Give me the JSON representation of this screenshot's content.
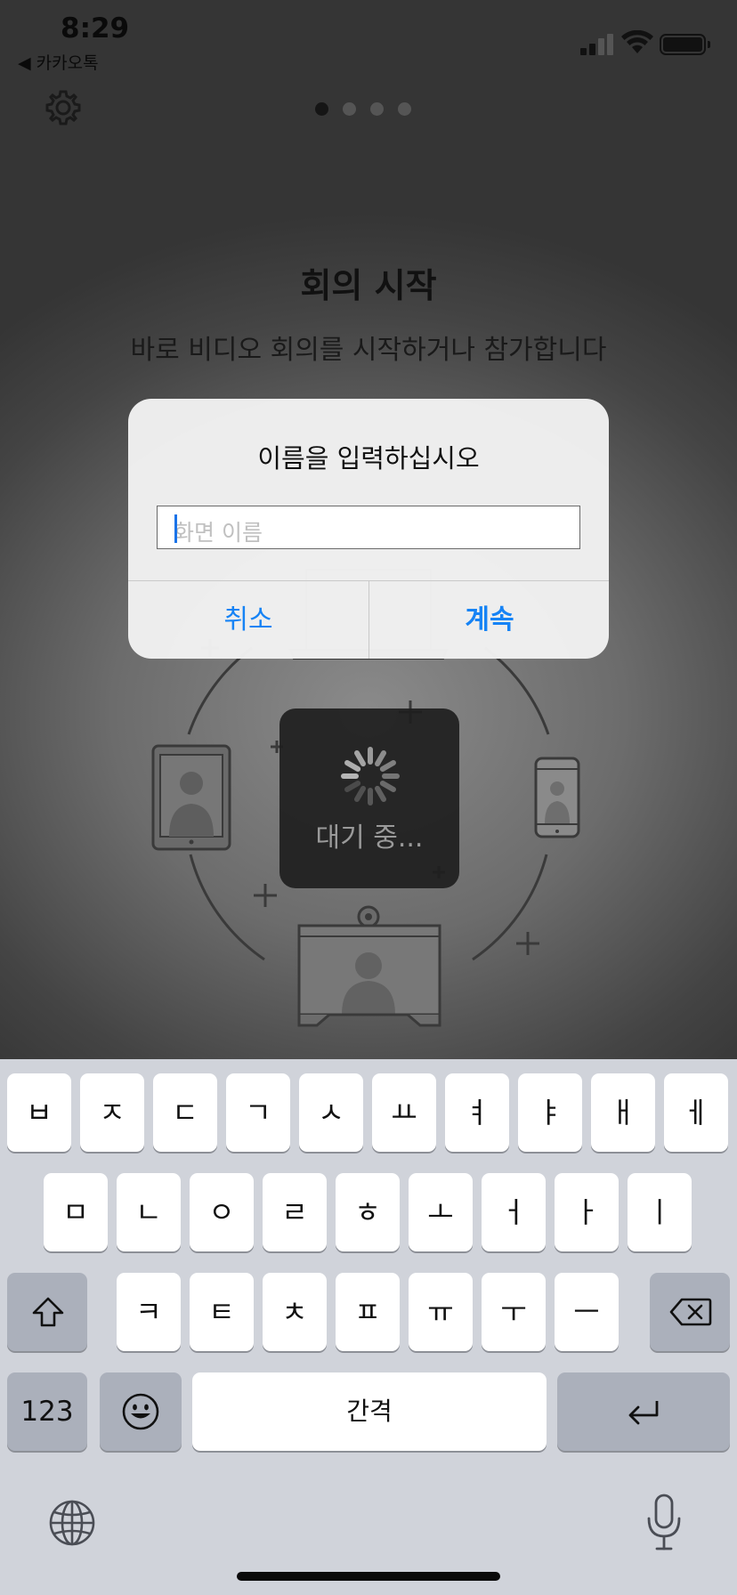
{
  "status_bar": {
    "time": "8:29",
    "back_app": "◀ 카카오톡"
  },
  "onboarding": {
    "page_dots": 4,
    "active_dot": 1,
    "title": "회의 시작",
    "subtitle": "바로 비디오 회의를 시작하거나 참가합니다"
  },
  "loading_hud": {
    "text": "대기 중..."
  },
  "dialog": {
    "title": "이름을 입력하십시오",
    "input_placeholder": "화면 이름",
    "input_value": "",
    "cancel_label": "취소",
    "continue_label": "계속",
    "accent_color": "#1683f5"
  },
  "keyboard": {
    "row1": [
      "ㅂ",
      "ㅈ",
      "ㄷ",
      "ㄱ",
      "ㅅ",
      "ㅛ",
      "ㅕ",
      "ㅑ",
      "ㅐ",
      "ㅔ"
    ],
    "row2": [
      "ㅁ",
      "ㄴ",
      "ㅇ",
      "ㄹ",
      "ㅎ",
      "ㅗ",
      "ㅓ",
      "ㅏ",
      "ㅣ"
    ],
    "row3": [
      "ㅋ",
      "ㅌ",
      "ㅊ",
      "ㅍ",
      "ㅠ",
      "ㅜ",
      "ㅡ"
    ],
    "numbers_label": "123",
    "space_label": "간격",
    "icons": [
      "shift-icon",
      "delete-icon",
      "emoji-icon",
      "return-icon",
      "globe-icon",
      "mic-icon"
    ]
  }
}
